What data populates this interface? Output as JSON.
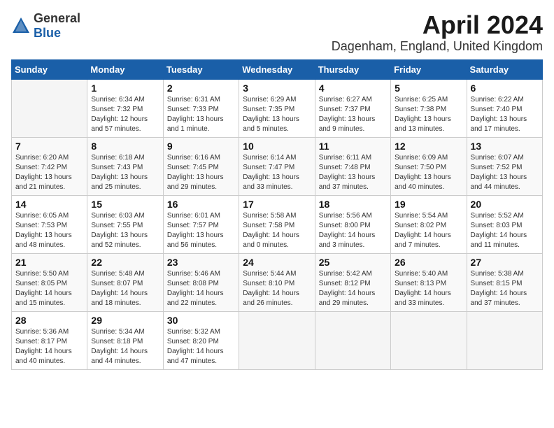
{
  "logo": {
    "general": "General",
    "blue": "Blue"
  },
  "title": "April 2024",
  "location": "Dagenham, England, United Kingdom",
  "days_of_week": [
    "Sunday",
    "Monday",
    "Tuesday",
    "Wednesday",
    "Thursday",
    "Friday",
    "Saturday"
  ],
  "weeks": [
    [
      {
        "day": "",
        "sunrise": "",
        "sunset": "",
        "daylight": "",
        "empty": true
      },
      {
        "day": "1",
        "sunrise": "Sunrise: 6:34 AM",
        "sunset": "Sunset: 7:32 PM",
        "daylight": "Daylight: 12 hours and 57 minutes.",
        "empty": false
      },
      {
        "day": "2",
        "sunrise": "Sunrise: 6:31 AM",
        "sunset": "Sunset: 7:33 PM",
        "daylight": "Daylight: 13 hours and 1 minute.",
        "empty": false
      },
      {
        "day": "3",
        "sunrise": "Sunrise: 6:29 AM",
        "sunset": "Sunset: 7:35 PM",
        "daylight": "Daylight: 13 hours and 5 minutes.",
        "empty": false
      },
      {
        "day": "4",
        "sunrise": "Sunrise: 6:27 AM",
        "sunset": "Sunset: 7:37 PM",
        "daylight": "Daylight: 13 hours and 9 minutes.",
        "empty": false
      },
      {
        "day": "5",
        "sunrise": "Sunrise: 6:25 AM",
        "sunset": "Sunset: 7:38 PM",
        "daylight": "Daylight: 13 hours and 13 minutes.",
        "empty": false
      },
      {
        "day": "6",
        "sunrise": "Sunrise: 6:22 AM",
        "sunset": "Sunset: 7:40 PM",
        "daylight": "Daylight: 13 hours and 17 minutes.",
        "empty": false
      }
    ],
    [
      {
        "day": "7",
        "sunrise": "Sunrise: 6:20 AM",
        "sunset": "Sunset: 7:42 PM",
        "daylight": "Daylight: 13 hours and 21 minutes.",
        "empty": false
      },
      {
        "day": "8",
        "sunrise": "Sunrise: 6:18 AM",
        "sunset": "Sunset: 7:43 PM",
        "daylight": "Daylight: 13 hours and 25 minutes.",
        "empty": false
      },
      {
        "day": "9",
        "sunrise": "Sunrise: 6:16 AM",
        "sunset": "Sunset: 7:45 PM",
        "daylight": "Daylight: 13 hours and 29 minutes.",
        "empty": false
      },
      {
        "day": "10",
        "sunrise": "Sunrise: 6:14 AM",
        "sunset": "Sunset: 7:47 PM",
        "daylight": "Daylight: 13 hours and 33 minutes.",
        "empty": false
      },
      {
        "day": "11",
        "sunrise": "Sunrise: 6:11 AM",
        "sunset": "Sunset: 7:48 PM",
        "daylight": "Daylight: 13 hours and 37 minutes.",
        "empty": false
      },
      {
        "day": "12",
        "sunrise": "Sunrise: 6:09 AM",
        "sunset": "Sunset: 7:50 PM",
        "daylight": "Daylight: 13 hours and 40 minutes.",
        "empty": false
      },
      {
        "day": "13",
        "sunrise": "Sunrise: 6:07 AM",
        "sunset": "Sunset: 7:52 PM",
        "daylight": "Daylight: 13 hours and 44 minutes.",
        "empty": false
      }
    ],
    [
      {
        "day": "14",
        "sunrise": "Sunrise: 6:05 AM",
        "sunset": "Sunset: 7:53 PM",
        "daylight": "Daylight: 13 hours and 48 minutes.",
        "empty": false
      },
      {
        "day": "15",
        "sunrise": "Sunrise: 6:03 AM",
        "sunset": "Sunset: 7:55 PM",
        "daylight": "Daylight: 13 hours and 52 minutes.",
        "empty": false
      },
      {
        "day": "16",
        "sunrise": "Sunrise: 6:01 AM",
        "sunset": "Sunset: 7:57 PM",
        "daylight": "Daylight: 13 hours and 56 minutes.",
        "empty": false
      },
      {
        "day": "17",
        "sunrise": "Sunrise: 5:58 AM",
        "sunset": "Sunset: 7:58 PM",
        "daylight": "Daylight: 14 hours and 0 minutes.",
        "empty": false
      },
      {
        "day": "18",
        "sunrise": "Sunrise: 5:56 AM",
        "sunset": "Sunset: 8:00 PM",
        "daylight": "Daylight: 14 hours and 3 minutes.",
        "empty": false
      },
      {
        "day": "19",
        "sunrise": "Sunrise: 5:54 AM",
        "sunset": "Sunset: 8:02 PM",
        "daylight": "Daylight: 14 hours and 7 minutes.",
        "empty": false
      },
      {
        "day": "20",
        "sunrise": "Sunrise: 5:52 AM",
        "sunset": "Sunset: 8:03 PM",
        "daylight": "Daylight: 14 hours and 11 minutes.",
        "empty": false
      }
    ],
    [
      {
        "day": "21",
        "sunrise": "Sunrise: 5:50 AM",
        "sunset": "Sunset: 8:05 PM",
        "daylight": "Daylight: 14 hours and 15 minutes.",
        "empty": false
      },
      {
        "day": "22",
        "sunrise": "Sunrise: 5:48 AM",
        "sunset": "Sunset: 8:07 PM",
        "daylight": "Daylight: 14 hours and 18 minutes.",
        "empty": false
      },
      {
        "day": "23",
        "sunrise": "Sunrise: 5:46 AM",
        "sunset": "Sunset: 8:08 PM",
        "daylight": "Daylight: 14 hours and 22 minutes.",
        "empty": false
      },
      {
        "day": "24",
        "sunrise": "Sunrise: 5:44 AM",
        "sunset": "Sunset: 8:10 PM",
        "daylight": "Daylight: 14 hours and 26 minutes.",
        "empty": false
      },
      {
        "day": "25",
        "sunrise": "Sunrise: 5:42 AM",
        "sunset": "Sunset: 8:12 PM",
        "daylight": "Daylight: 14 hours and 29 minutes.",
        "empty": false
      },
      {
        "day": "26",
        "sunrise": "Sunrise: 5:40 AM",
        "sunset": "Sunset: 8:13 PM",
        "daylight": "Daylight: 14 hours and 33 minutes.",
        "empty": false
      },
      {
        "day": "27",
        "sunrise": "Sunrise: 5:38 AM",
        "sunset": "Sunset: 8:15 PM",
        "daylight": "Daylight: 14 hours and 37 minutes.",
        "empty": false
      }
    ],
    [
      {
        "day": "28",
        "sunrise": "Sunrise: 5:36 AM",
        "sunset": "Sunset: 8:17 PM",
        "daylight": "Daylight: 14 hours and 40 minutes.",
        "empty": false
      },
      {
        "day": "29",
        "sunrise": "Sunrise: 5:34 AM",
        "sunset": "Sunset: 8:18 PM",
        "daylight": "Daylight: 14 hours and 44 minutes.",
        "empty": false
      },
      {
        "day": "30",
        "sunrise": "Sunrise: 5:32 AM",
        "sunset": "Sunset: 8:20 PM",
        "daylight": "Daylight: 14 hours and 47 minutes.",
        "empty": false
      },
      {
        "day": "",
        "sunrise": "",
        "sunset": "",
        "daylight": "",
        "empty": true
      },
      {
        "day": "",
        "sunrise": "",
        "sunset": "",
        "daylight": "",
        "empty": true
      },
      {
        "day": "",
        "sunrise": "",
        "sunset": "",
        "daylight": "",
        "empty": true
      },
      {
        "day": "",
        "sunrise": "",
        "sunset": "",
        "daylight": "",
        "empty": true
      }
    ]
  ]
}
